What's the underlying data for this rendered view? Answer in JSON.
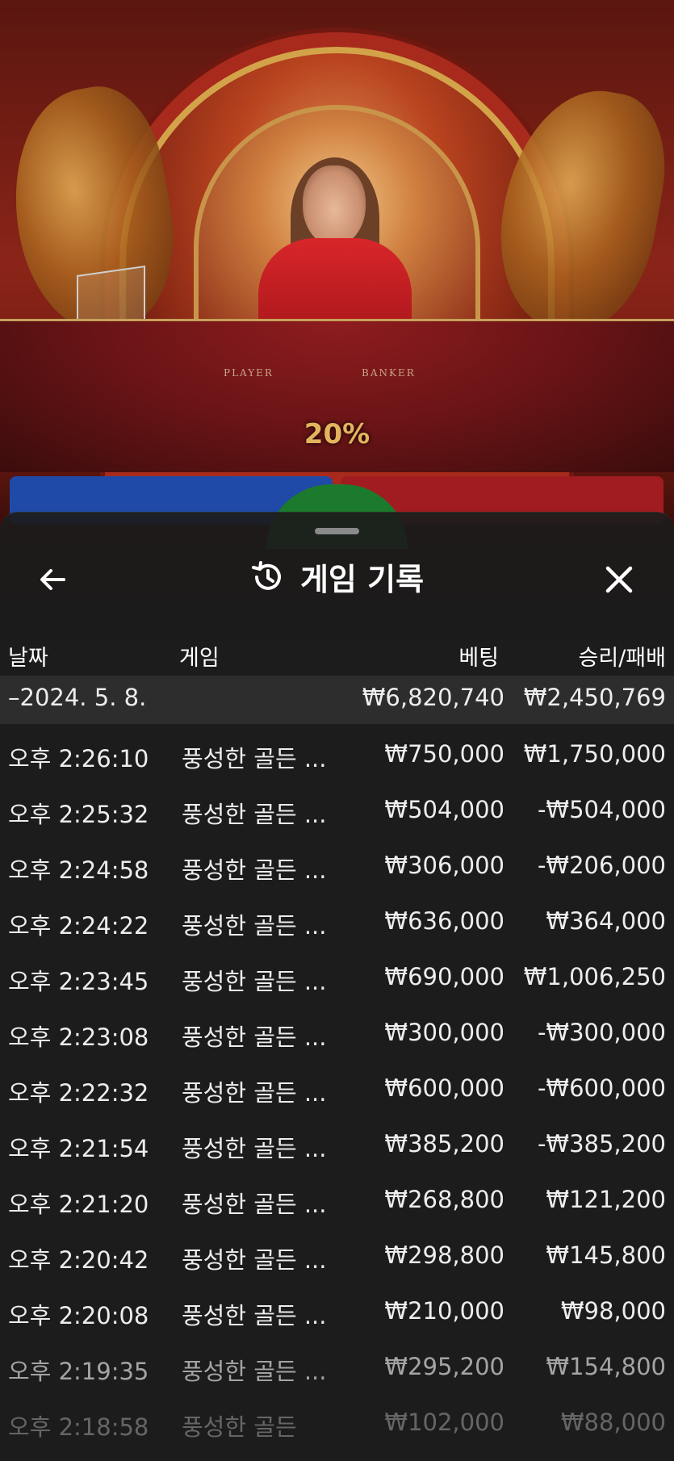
{
  "stream": {
    "table_labels": {
      "player": "PLAYER",
      "banker": "BANKER"
    },
    "progress_percent_text": "20%"
  },
  "sheet": {
    "title": "게임 기록",
    "icons": {
      "back": "arrow-left-icon",
      "history": "history-icon",
      "close": "close-icon"
    },
    "columns": {
      "date": "날짜",
      "game": "게임",
      "bet": "베팅",
      "win_loss": "승리/패배"
    },
    "summary": {
      "date": "–2024. 5. 8.",
      "bet": "₩6,820,740",
      "win_loss": "₩2,450,769"
    },
    "rows": [
      {
        "time": "오후 2:26:10",
        "game": "풍성한 골든 ...",
        "bet": "₩750,000",
        "win_loss": "₩1,750,000"
      },
      {
        "time": "오후 2:25:32",
        "game": "풍성한 골든 ...",
        "bet": "₩504,000",
        "win_loss": "-₩504,000"
      },
      {
        "time": "오후 2:24:58",
        "game": "풍성한 골든 ...",
        "bet": "₩306,000",
        "win_loss": "-₩206,000"
      },
      {
        "time": "오후 2:24:22",
        "game": "풍성한 골든 ...",
        "bet": "₩636,000",
        "win_loss": "₩364,000"
      },
      {
        "time": "오후 2:23:45",
        "game": "풍성한 골든 ...",
        "bet": "₩690,000",
        "win_loss": "₩1,006,250"
      },
      {
        "time": "오후 2:23:08",
        "game": "풍성한 골든 ...",
        "bet": "₩300,000",
        "win_loss": "-₩300,000"
      },
      {
        "time": "오후 2:22:32",
        "game": "풍성한 골든 ...",
        "bet": "₩600,000",
        "win_loss": "-₩600,000"
      },
      {
        "time": "오후 2:21:54",
        "game": "풍성한 골든 ...",
        "bet": "₩385,200",
        "win_loss": "-₩385,200"
      },
      {
        "time": "오후 2:21:20",
        "game": "풍성한 골든 ...",
        "bet": "₩268,800",
        "win_loss": "₩121,200"
      },
      {
        "time": "오후 2:20:42",
        "game": "풍성한 골든 ...",
        "bet": "₩298,800",
        "win_loss": "₩145,800"
      },
      {
        "time": "오후 2:20:08",
        "game": "풍성한 골든 ...",
        "bet": "₩210,000",
        "win_loss": "₩98,000"
      },
      {
        "time": "오후 2:19:35",
        "game": "풍성한 골든 ...",
        "bet": "₩295,200",
        "win_loss": "₩154,800"
      },
      {
        "time": "오후 2:18:58",
        "game": "풍성한 골든",
        "bet": "₩102,000",
        "win_loss": "₩88,000"
      }
    ]
  }
}
